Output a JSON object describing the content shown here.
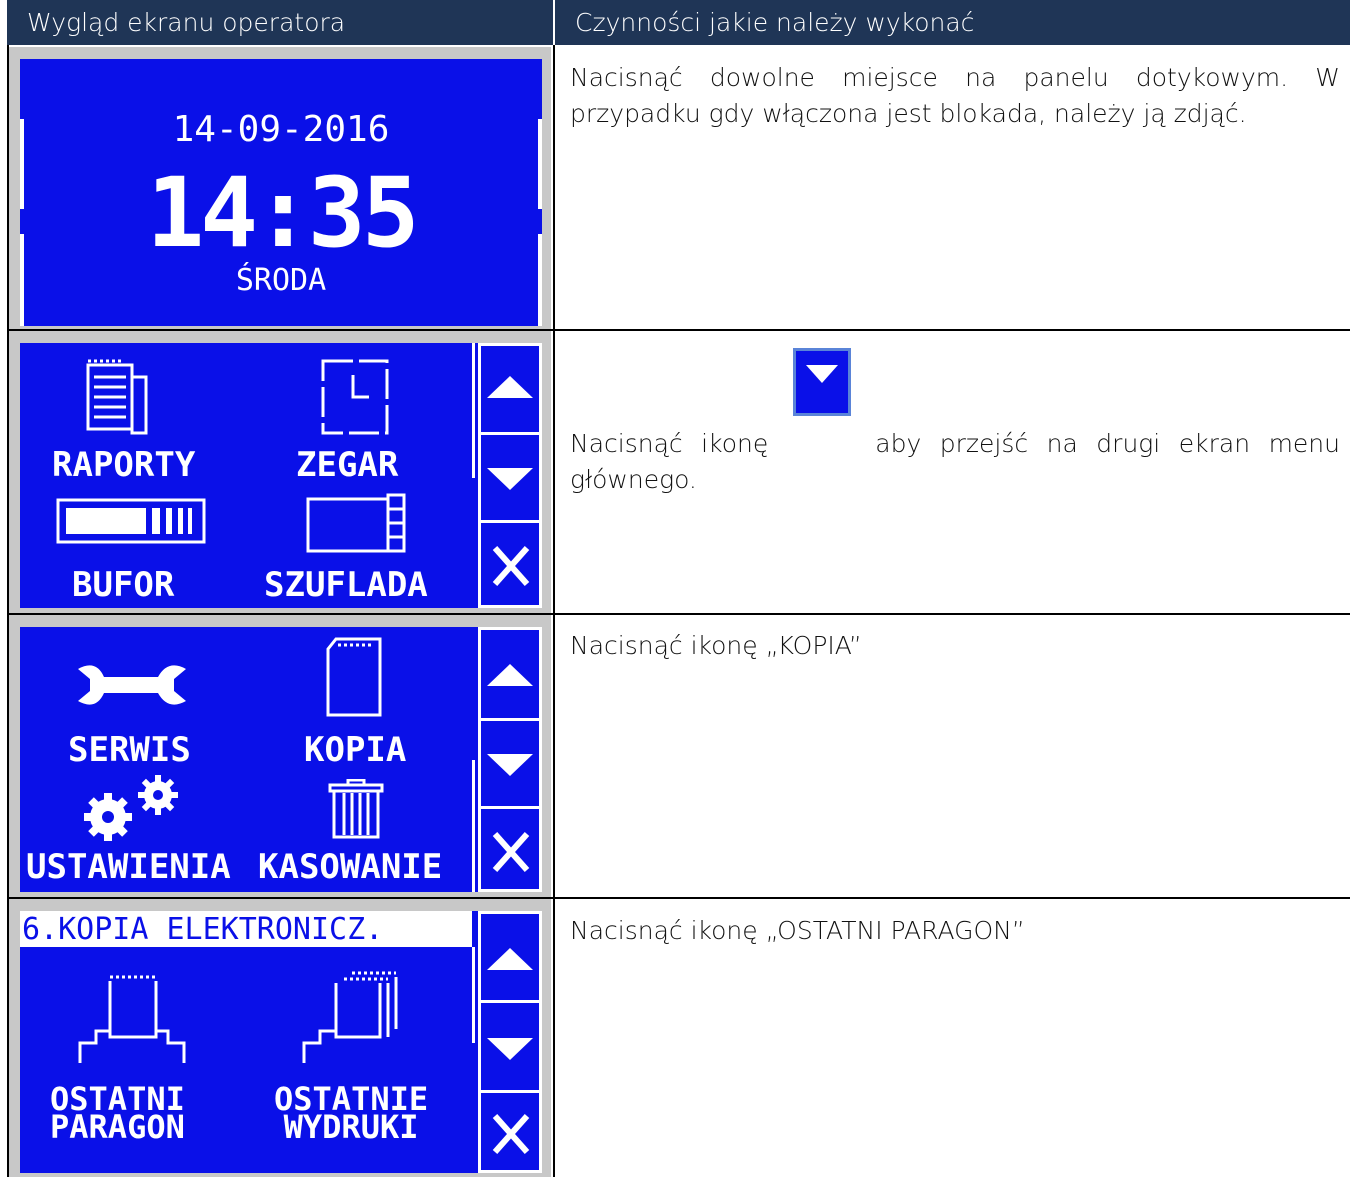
{
  "header": {
    "left": "Wygląd ekranu operatora",
    "right": "Czynności jakie należy wykonać"
  },
  "rows": [
    {
      "screen": {
        "date": "14-09-2016",
        "time": "14:35",
        "day": "ŚRODA"
      },
      "instruction": "Nacisnąć dowolne miejsce na panelu dotykowym. W przypadku gdy włączona jest blokada, należy ją zdjąć."
    },
    {
      "screen": {
        "items": [
          "RAPORTY",
          "ZEGAR",
          "BUFOR",
          "SZUFLADA"
        ]
      },
      "instruction_before": "Nacisnąć ikonę",
      "instruction_after": "aby przejść na drugi ekran menu głównego."
    },
    {
      "screen": {
        "items": [
          "SERWIS",
          "KOPIA",
          "USTAWIENIA",
          "KASOWANIE"
        ]
      },
      "instruction": "Nacisnąć ikonę „KOPIA”"
    },
    {
      "screen": {
        "title": "6.KOPIA ELEKTRONICZ.",
        "items": [
          "OSTATNI\nPARAGON",
          "OSTATNIE\nWYDRUKI"
        ],
        "item1_line1": "OSTATNI",
        "item1_line2": "PARAGON",
        "item2_line1": "OSTATNIE",
        "item2_line2": "WYDRUKI"
      },
      "instruction": "Nacisnąć ikonę  „OSTATNI PARAGON”"
    }
  ],
  "colors": {
    "screen_blue": "#0a10e8",
    "header_bg": "#1f3556",
    "frame_grey": "#c8c8c8"
  },
  "icons": [
    "report-icon",
    "clock-icon",
    "buffer-icon",
    "drawer-icon",
    "wrench-icon",
    "sd-card-icon",
    "gears-icon",
    "trash-icon",
    "printer-icon",
    "printer-copies-icon",
    "scroll-up-icon",
    "scroll-down-icon",
    "close-icon"
  ]
}
